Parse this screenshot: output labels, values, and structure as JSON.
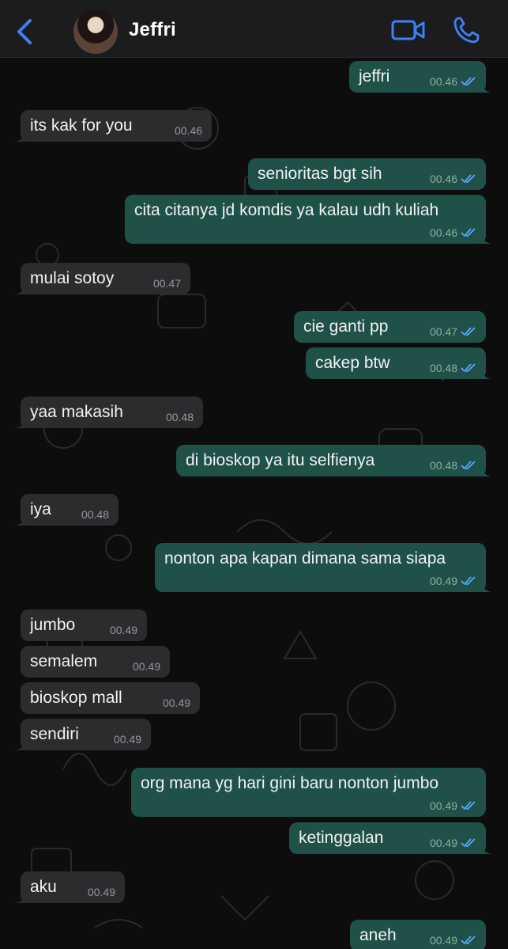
{
  "header": {
    "contact_name": "Jeffri",
    "back_icon": "chevron-left-icon",
    "video_icon": "video-camera-icon",
    "call_icon": "phone-icon",
    "accent_color": "#3b82f6"
  },
  "colors": {
    "outgoing_bubble": "#1f5148",
    "incoming_bubble": "#2c2c2e",
    "read_ticks": "#5aa7ff"
  },
  "messages": [
    {
      "dir": "out",
      "text": "jeffri",
      "time": "00.46",
      "read": true
    },
    {
      "dir": "in",
      "text": "its kak for you",
      "time": "00.46"
    },
    {
      "dir": "out",
      "text": "senioritas bgt sih",
      "time": "00.46",
      "read": true
    },
    {
      "dir": "out",
      "text": "cita citanya jd komdis ya kalau udh kuliah",
      "time": "00.46",
      "read": true
    },
    {
      "dir": "in",
      "text": "mulai sotoy",
      "time": "00.47"
    },
    {
      "dir": "out",
      "text": "cie ganti pp",
      "time": "00.47",
      "read": true
    },
    {
      "dir": "out",
      "text": "cakep btw",
      "time": "00.48",
      "read": true
    },
    {
      "dir": "in",
      "text": "yaa makasih",
      "time": "00.48"
    },
    {
      "dir": "out",
      "text": "di bioskop ya itu selfienya",
      "time": "00.48",
      "read": true
    },
    {
      "dir": "in",
      "text": "iya",
      "time": "00.48"
    },
    {
      "dir": "out",
      "text": "nonton apa kapan dimana sama siapa",
      "time": "00.49",
      "read": true
    },
    {
      "dir": "in",
      "text": "jumbo",
      "time": "00.49"
    },
    {
      "dir": "in",
      "text": "semalem",
      "time": "00.49"
    },
    {
      "dir": "in",
      "text": "bioskop mall",
      "time": "00.49"
    },
    {
      "dir": "in",
      "text": "sendiri",
      "time": "00.49"
    },
    {
      "dir": "out",
      "text": "org mana yg hari gini baru nonton jumbo",
      "time": "00.49",
      "read": true
    },
    {
      "dir": "out",
      "text": "ketinggalan",
      "time": "00.49",
      "read": true
    },
    {
      "dir": "in",
      "text": "aku",
      "time": "00.49"
    },
    {
      "dir": "out",
      "text": "aneh",
      "time": "00.49",
      "read": true
    }
  ]
}
